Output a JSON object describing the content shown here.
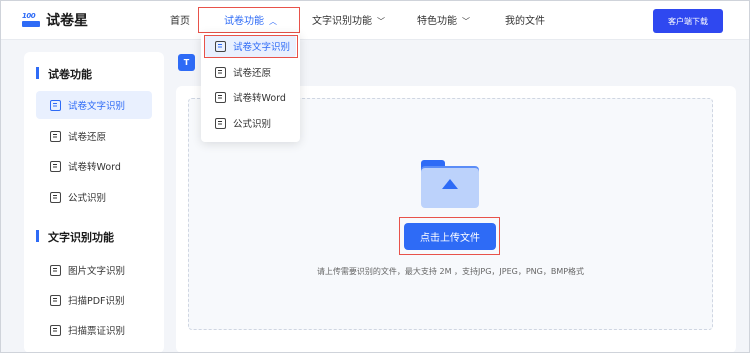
{
  "header": {
    "logo_text": "试卷星",
    "logo_mark": "100",
    "nav": [
      {
        "label": "首页"
      },
      {
        "label": "试卷功能"
      },
      {
        "label": "文字识别功能"
      },
      {
        "label": "特色功能"
      },
      {
        "label": "我的文件"
      }
    ],
    "download_label": "客户端下载",
    "accent_color": "#2e6bf6",
    "highlight_color": "#e8524a"
  },
  "dropdown": {
    "items": [
      {
        "label": "试卷文字识别"
      },
      {
        "label": "试卷还原"
      },
      {
        "label": "试卷转Word"
      },
      {
        "label": "公式识别"
      }
    ]
  },
  "sidebar": {
    "sections": [
      {
        "title": "试卷功能",
        "items": [
          {
            "label": "试卷文字识别"
          },
          {
            "label": "试卷还原"
          },
          {
            "label": "试卷转Word"
          },
          {
            "label": "公式识别"
          }
        ]
      },
      {
        "title": "文字识别功能",
        "items": [
          {
            "label": "图片文字识别"
          },
          {
            "label": "扫描PDF识别"
          },
          {
            "label": "扫描票证识别"
          }
        ]
      }
    ]
  },
  "main": {
    "badge": "T",
    "upload_label": "点击上传文件",
    "hint": "请上传需要识别的文件，最大支持 2M ，支持JPG，JPEG，PNG，BMP格式"
  }
}
